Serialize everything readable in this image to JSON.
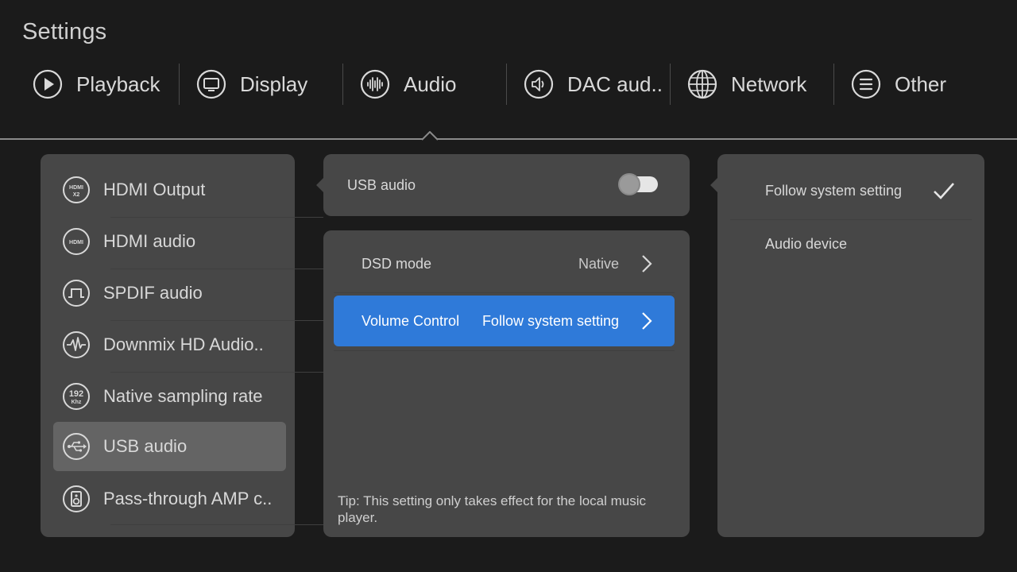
{
  "page": {
    "title": "Settings"
  },
  "tabs": [
    {
      "label": "Playback",
      "icon": "play-icon"
    },
    {
      "label": "Display",
      "icon": "monitor-icon"
    },
    {
      "label": "Audio",
      "icon": "audio-wave-icon",
      "active": true
    },
    {
      "label": "DAC aud..",
      "icon": "speaker-icon"
    },
    {
      "label": "Network",
      "icon": "globe-icon"
    },
    {
      "label": "Other",
      "icon": "menu-list-icon"
    }
  ],
  "sidebar": {
    "items": [
      {
        "label": "HDMI Output",
        "icon": "hdmi-x2-icon",
        "icon_text": "HDMI",
        "icon_sub": "X2"
      },
      {
        "label": "HDMI audio",
        "icon": "hdmi-icon",
        "icon_text": "HDMI"
      },
      {
        "label": "SPDIF audio",
        "icon": "spdif-pulse-icon"
      },
      {
        "label": "Downmix HD Audio..",
        "icon": "waveform-icon"
      },
      {
        "label": "Native sampling rate",
        "icon": "sample-rate-192-icon",
        "icon_text": "192",
        "icon_sub": "Khz"
      },
      {
        "label": "USB audio",
        "icon": "usb-icon",
        "selected": true
      },
      {
        "label": "Pass-through AMP c..",
        "icon": "amp-speaker-icon"
      }
    ]
  },
  "usb_panel": {
    "label": "USB audio",
    "toggle_on": false
  },
  "settings": {
    "rows": [
      {
        "label": "DSD mode",
        "value": "Native"
      },
      {
        "label": "Volume Control",
        "value": "Follow system setting",
        "highlighted": true
      }
    ],
    "tip": "Tip: This setting only takes effect for the local music player."
  },
  "options": {
    "items": [
      {
        "label": "Follow system setting",
        "checked": true
      },
      {
        "label": "Audio device",
        "checked": false
      }
    ]
  },
  "colors": {
    "background": "#1b1b1b",
    "panel": "#474747",
    "selected": "#646464",
    "accent": "#2f7ad9",
    "text": "#d8d8d8"
  }
}
